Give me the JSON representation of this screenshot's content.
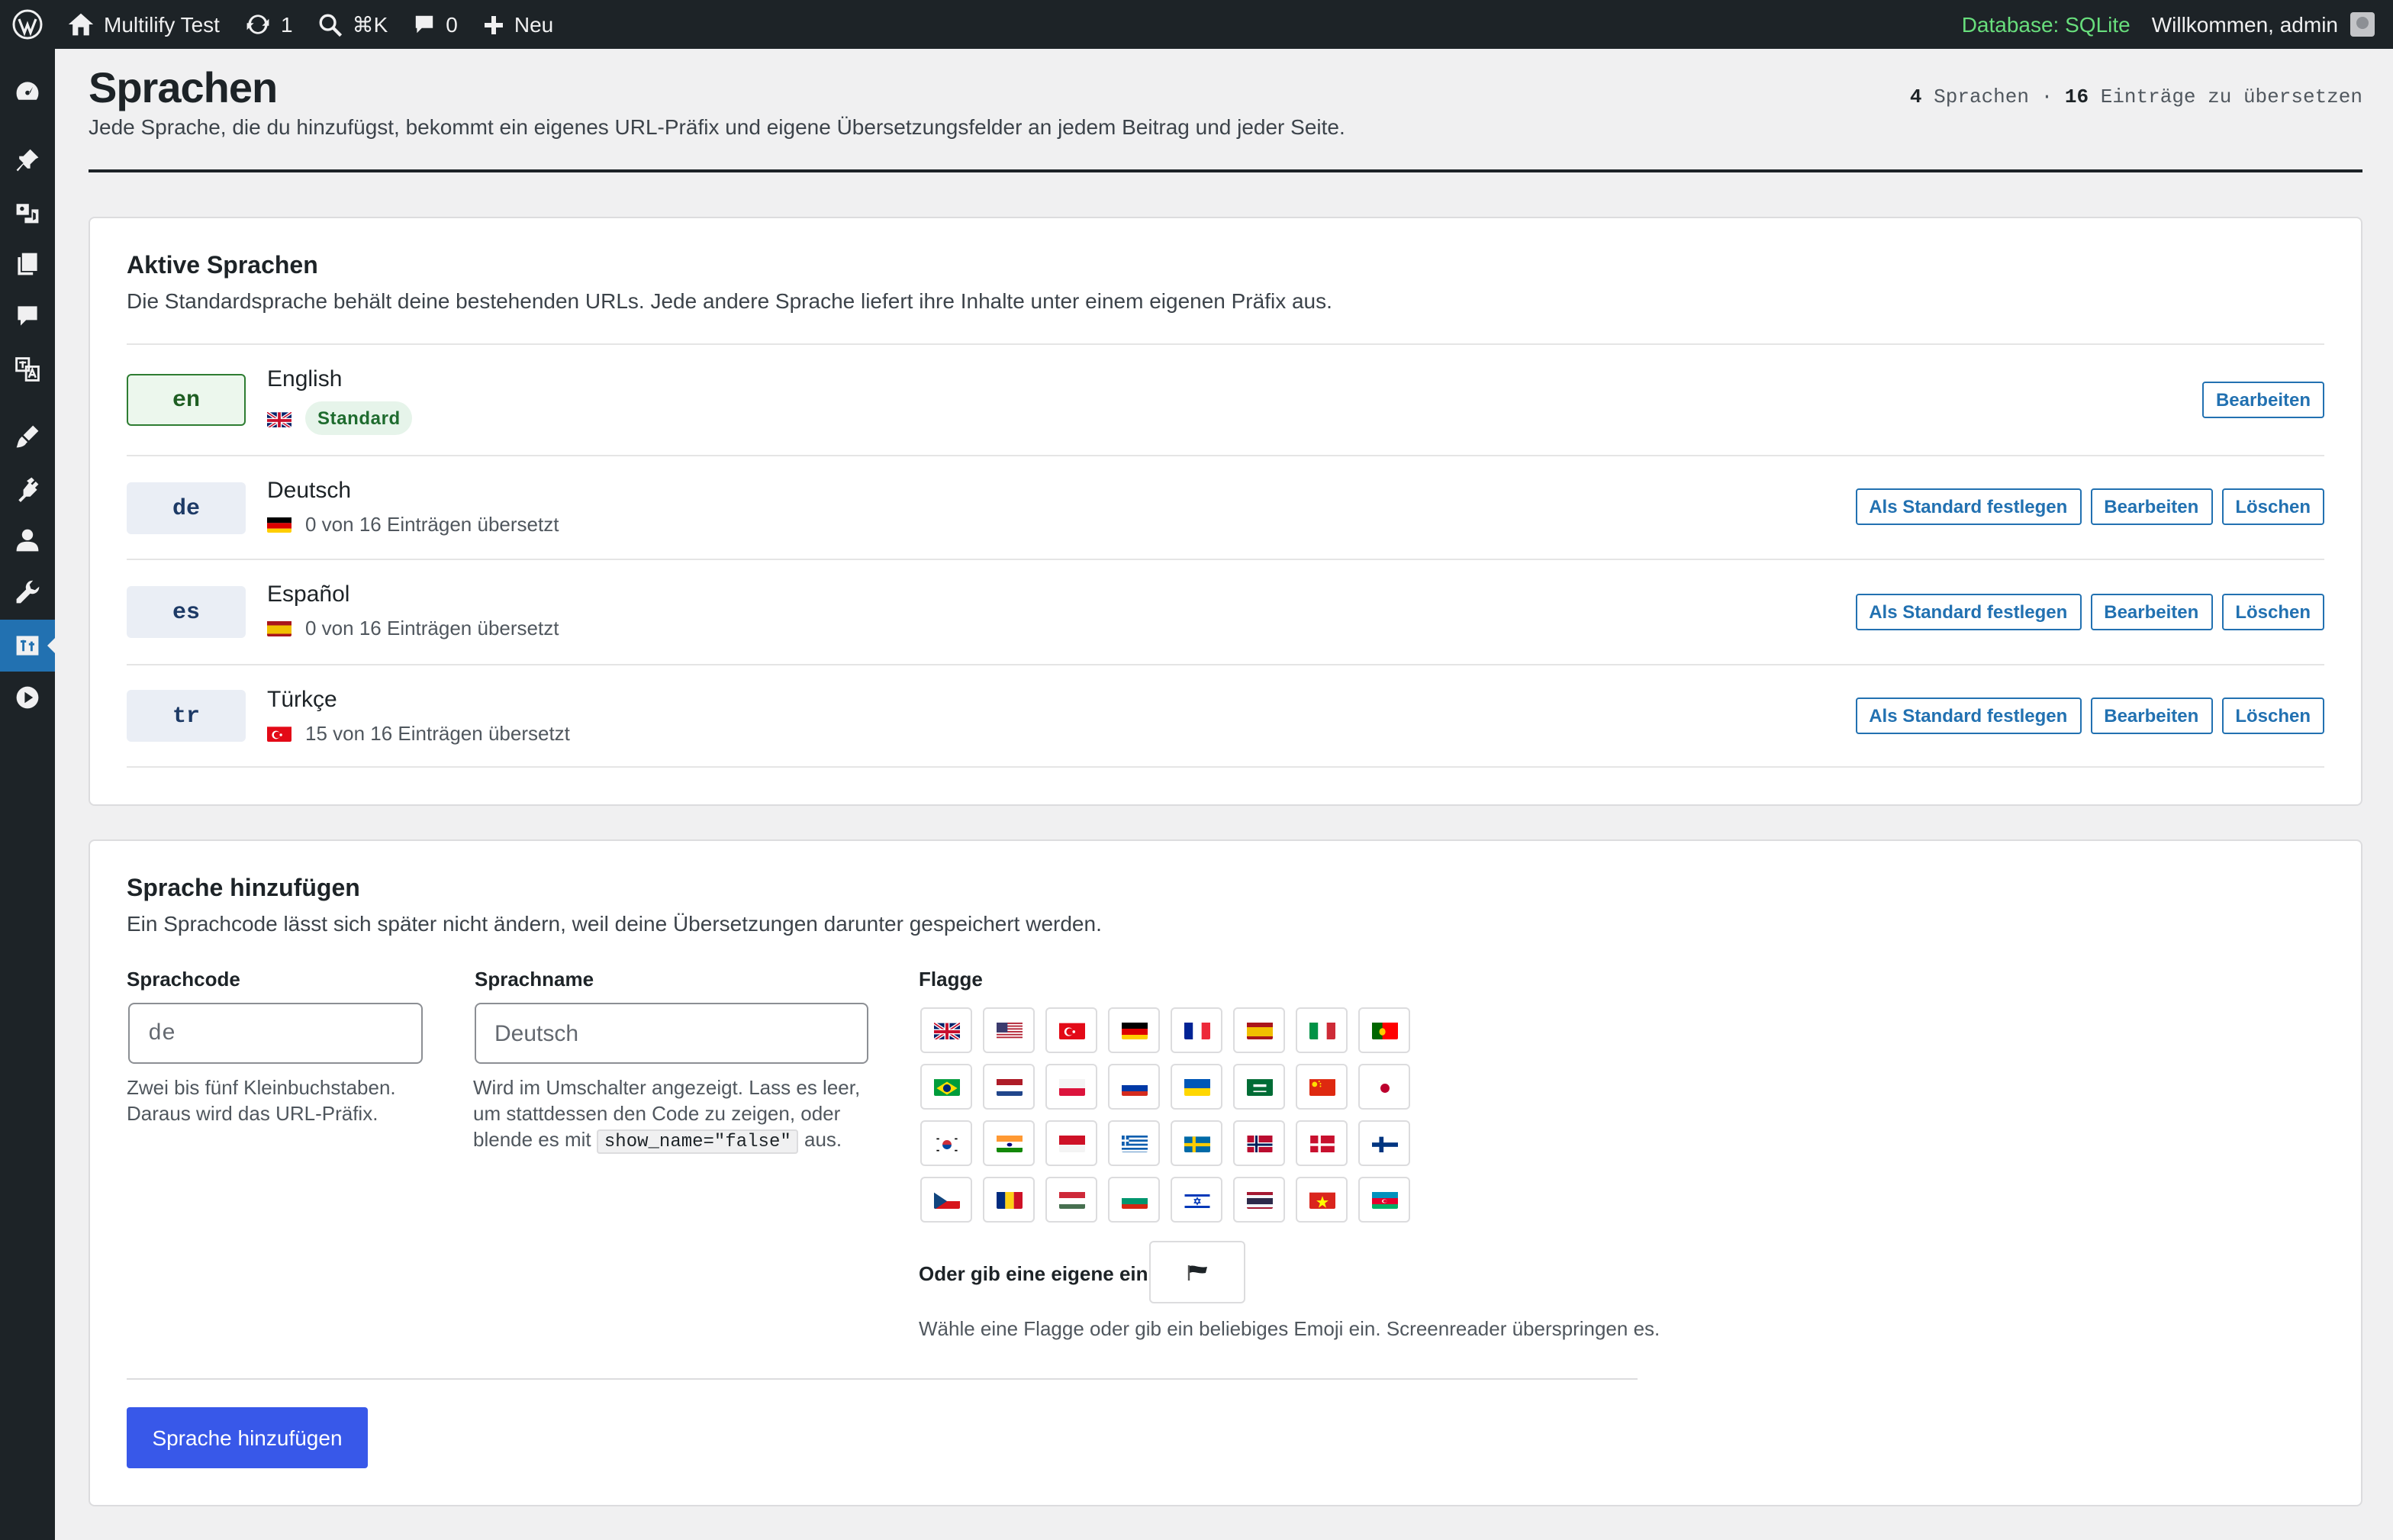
{
  "adminbar": {
    "site_name": "Multilify Test",
    "updates_count": "1",
    "search_shortcut": "⌘K",
    "comments_count": "0",
    "new_label": "Neu",
    "database": "Database: SQLite",
    "welcome": "Willkommen, admin"
  },
  "sidebar": {
    "icons": [
      "dashboard-icon",
      "posts-icon",
      "media-icon",
      "pages-icon",
      "comments-icon",
      "translate-icon",
      "appearance-icon",
      "plugins-icon",
      "users-icon",
      "tools-icon",
      "languages-icon",
      "play-icon"
    ],
    "active": "languages-icon"
  },
  "header": {
    "title": "Sprachen",
    "description": "Jede Sprache, die du hinzufügst, bekommt ein eigenes URL-Präfix und eigene Übersetzungsfelder an jedem Beitrag und jeder Seite.",
    "stats": {
      "languages_count": "4",
      "languages_label": "Sprachen",
      "separator": "·",
      "entries_count": "16",
      "entries_label": "Einträge zu übersetzen"
    }
  },
  "active_languages": {
    "title": "Aktive Sprachen",
    "description": "Die Standardsprache behält deine bestehenden URLs. Jede andere Sprache liefert ihre Inhalte unter einem eigenen Präfix aus.",
    "languages": [
      {
        "code": "en",
        "name": "English",
        "flag": "gb",
        "is_default": true,
        "meta": "Standard",
        "actions": [
          "Bearbeiten"
        ]
      },
      {
        "code": "de",
        "name": "Deutsch",
        "flag": "de",
        "is_default": false,
        "meta": "0 von 16 Einträgen übersetzt",
        "actions": [
          "Als Standard festlegen",
          "Bearbeiten",
          "Löschen"
        ]
      },
      {
        "code": "es",
        "name": "Español",
        "flag": "es",
        "is_default": false,
        "meta": "0 von 16 Einträgen übersetzt",
        "actions": [
          "Als Standard festlegen",
          "Bearbeiten",
          "Löschen"
        ]
      },
      {
        "code": "tr",
        "name": "Türkçe",
        "flag": "tr",
        "is_default": false,
        "meta": "15 von 16 Einträgen übersetzt",
        "actions": [
          "Als Standard festlegen",
          "Bearbeiten",
          "Löschen"
        ]
      }
    ]
  },
  "add_language": {
    "title": "Sprache hinzufügen",
    "description": "Ein Sprachcode lässt sich später nicht ändern, weil deine Übersetzungen darunter gespeichert werden.",
    "code_field": {
      "label": "Sprachcode",
      "placeholder": "de",
      "help_line1": "Zwei bis fünf Kleinbuchstaben.",
      "help_line2": "Daraus wird das URL-Präfix."
    },
    "name_field": {
      "label": "Sprachname",
      "placeholder": "Deutsch",
      "help_line1": "Wird im Umschalter angezeigt. Lass es leer,",
      "help_line2": "um stattdessen den Code zu zeigen, oder",
      "help_line3_pre": "blende es mit",
      "help_code": "show_name=\"false\"",
      "help_line3_post": "aus."
    },
    "flag_field": {
      "label": "Flagge",
      "flags": [
        "gb",
        "us",
        "tr",
        "de",
        "fr",
        "es",
        "it",
        "pt",
        "br",
        "nl",
        "pl",
        "ru",
        "ua",
        "sa",
        "cn",
        "jp",
        "kr",
        "in",
        "id",
        "gr",
        "se",
        "no",
        "dk",
        "fi",
        "cz",
        "ro",
        "hu",
        "bg",
        "il",
        "th",
        "vn",
        "az"
      ],
      "custom_label": "Oder gib eine eigene ein",
      "custom_value": "black-flag",
      "help": "Wähle eine Flagge oder gib ein beliebiges Emoji ein. Screenreader überspringen es."
    },
    "submit_label": "Sprache hinzufügen"
  }
}
